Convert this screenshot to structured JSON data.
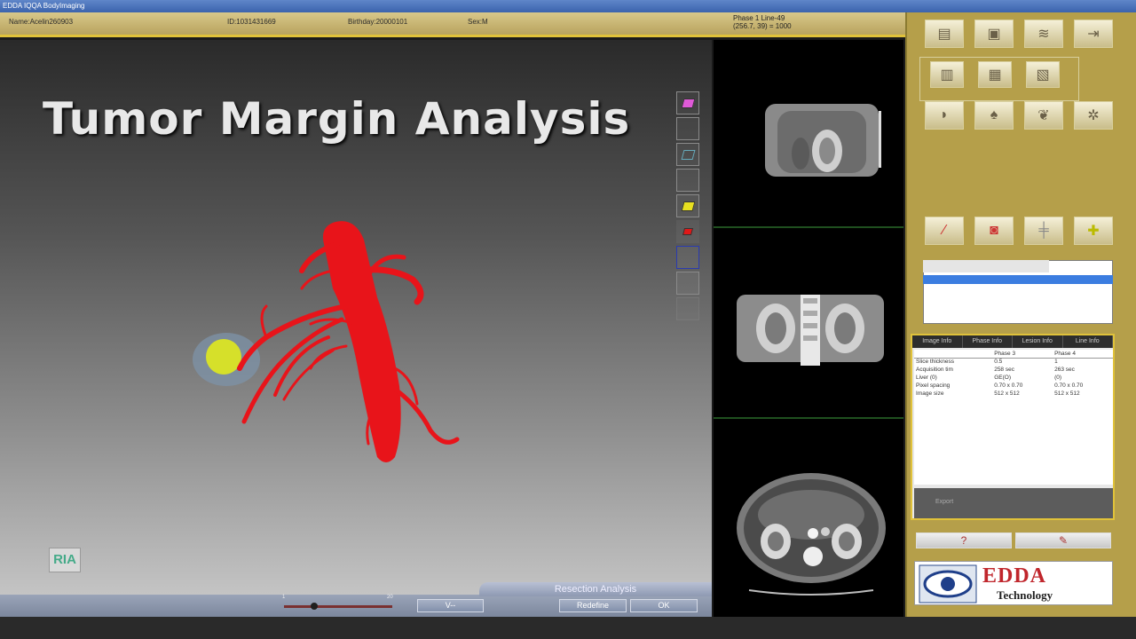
{
  "window": {
    "title": "EDDA IQQA BodyImaging"
  },
  "patient": {
    "name": "Name:Acelin260903",
    "id": "ID:1031431669",
    "birthday": "Birthday:20000101",
    "sex": "Sex:M"
  },
  "view_info": {
    "line1": "Phase 1   Line-49",
    "line2": "(256.7, 39) = 1000"
  },
  "main": {
    "title": "Tumor Margin Analysis"
  },
  "logos": {
    "ria": "RIA"
  },
  "bottom": {
    "panel_title": "Resection Analysis",
    "slider_min": "1",
    "slider_max": "20",
    "btn_view": "V--",
    "btn_redefine": "Redefine",
    "btn_ok": "OK"
  },
  "info_panel": {
    "tabs": [
      "Image Info",
      "Phase Info",
      "Lesion Info",
      "Line Info"
    ],
    "columns": [
      "",
      "Phase 3",
      "Phase 4"
    ],
    "rows": [
      [
        "Slice thickness",
        "0.5",
        "1"
      ],
      [
        "Acquisition tim",
        "258 sec",
        "263 sec"
      ],
      [
        "Liver (0)",
        "GE(O)",
        "(0)"
      ],
      [
        "Pixel spacing",
        "0.70 x 0.70",
        "0.70 x 0.70"
      ],
      [
        "Image size",
        "512 x 512",
        "512 x 512"
      ]
    ],
    "footer_label": "Export"
  },
  "company": {
    "name": "EDDA",
    "sub": "Technology"
  },
  "colors": {
    "vessel": "#e8141a",
    "tumor": "#d6e02a",
    "panel_gold": "#b59f4a"
  }
}
